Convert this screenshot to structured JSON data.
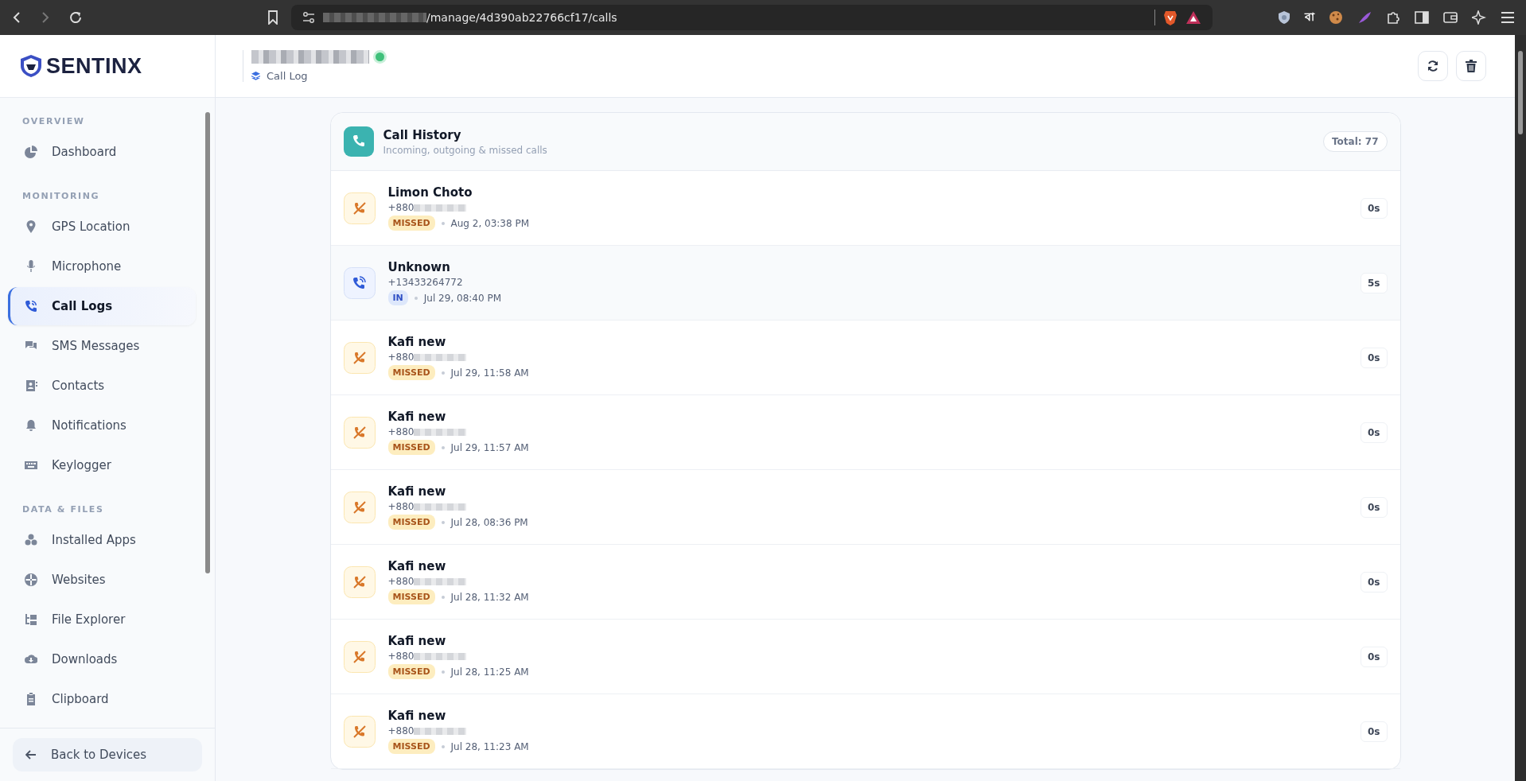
{
  "browser": {
    "url": "/manage/4d390ab22766cf17/calls",
    "extension_label": "বা"
  },
  "brand": {
    "name": "SENTINX"
  },
  "sidebar": {
    "sections": [
      {
        "title": "OVERVIEW",
        "items": [
          {
            "label": "Dashboard",
            "selected": false
          }
        ]
      },
      {
        "title": "MONITORING",
        "items": [
          {
            "label": "GPS Location",
            "selected": false
          },
          {
            "label": "Microphone",
            "selected": false
          },
          {
            "label": "Call Logs",
            "selected": true
          },
          {
            "label": "SMS Messages",
            "selected": false
          },
          {
            "label": "Contacts",
            "selected": false
          },
          {
            "label": "Notifications",
            "selected": false
          },
          {
            "label": "Keylogger",
            "selected": false
          }
        ]
      },
      {
        "title": "DATA & FILES",
        "items": [
          {
            "label": "Installed Apps",
            "selected": false
          },
          {
            "label": "Websites",
            "selected": false
          },
          {
            "label": "File Explorer",
            "selected": false
          },
          {
            "label": "Downloads",
            "selected": false
          },
          {
            "label": "Clipboard",
            "selected": false
          }
        ]
      }
    ],
    "back_button": "Back to Devices"
  },
  "header": {
    "device_online": true,
    "breadcrumb": "Call Log"
  },
  "card": {
    "title": "Call History",
    "subtitle": "Incoming, outgoing & missed calls",
    "total": "Total: 77"
  },
  "calls": [
    {
      "kind": "missed",
      "name": "Limon Choto",
      "number": "+880",
      "number_redacted": true,
      "badge": "MISSED",
      "time": "Aug 2, 03:38 PM",
      "duration": "0s"
    },
    {
      "kind": "in",
      "name": "Unknown",
      "number": "+13433264772",
      "number_redacted": false,
      "badge": "IN",
      "time": "Jul 29, 08:40 PM",
      "duration": "5s"
    },
    {
      "kind": "missed",
      "name": "Kafi new",
      "number": "+880",
      "number_redacted": true,
      "badge": "MISSED",
      "time": "Jul 29, 11:58 AM",
      "duration": "0s"
    },
    {
      "kind": "missed",
      "name": "Kafi new",
      "number": "+880",
      "number_redacted": true,
      "badge": "MISSED",
      "time": "Jul 29, 11:57 AM",
      "duration": "0s"
    },
    {
      "kind": "missed",
      "name": "Kafi new",
      "number": "+880",
      "number_redacted": true,
      "badge": "MISSED",
      "time": "Jul 28, 08:36 PM",
      "duration": "0s"
    },
    {
      "kind": "missed",
      "name": "Kafi new",
      "number": "+880",
      "number_redacted": true,
      "badge": "MISSED",
      "time": "Jul 28, 11:32 AM",
      "duration": "0s"
    },
    {
      "kind": "missed",
      "name": "Kafi new",
      "number": "+880",
      "number_redacted": true,
      "badge": "MISSED",
      "time": "Jul 28, 11:25 AM",
      "duration": "0s"
    },
    {
      "kind": "missed",
      "name": "Kafi new",
      "number": "+880",
      "number_redacted": true,
      "badge": "MISSED",
      "time": "Jul 28, 11:23 AM",
      "duration": "0s"
    }
  ]
}
